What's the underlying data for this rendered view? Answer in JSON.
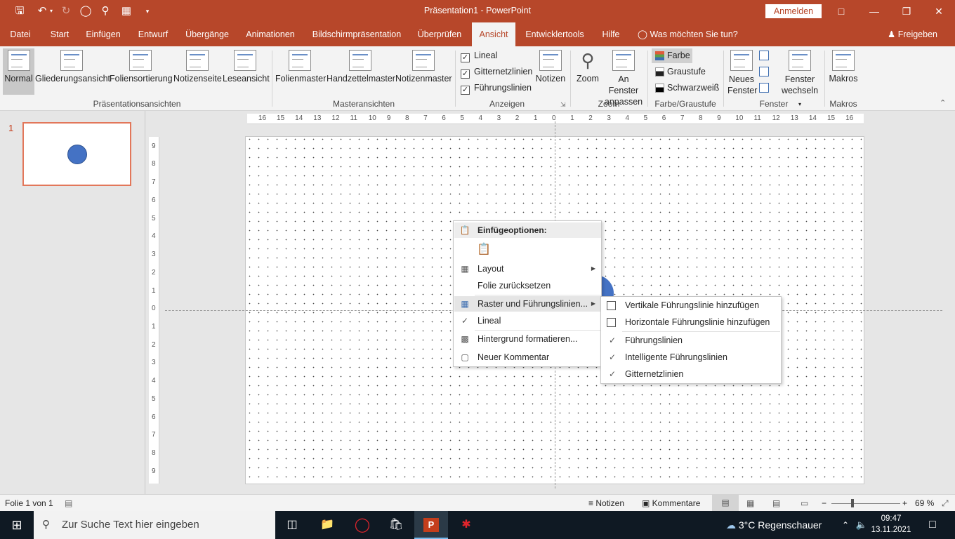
{
  "window": {
    "title": "Präsentation1  -  PowerPoint",
    "signin_label": "Anmelden",
    "minimize_icon": "minimize-icon",
    "restore_icon": "restore-icon",
    "close_icon": "close-icon"
  },
  "tabs": [
    {
      "label": "Datei"
    },
    {
      "label": "Start"
    },
    {
      "label": "Einfügen"
    },
    {
      "label": "Entwurf"
    },
    {
      "label": "Übergänge"
    },
    {
      "label": "Animationen"
    },
    {
      "label": "Bildschirmpräsentation"
    },
    {
      "label": "Überprüfen"
    },
    {
      "label": "Ansicht"
    },
    {
      "label": "Entwicklertools"
    },
    {
      "label": "Hilfe"
    }
  ],
  "active_tab": "Ansicht",
  "tellme": "Was möchten Sie tun?",
  "share": "Freigeben",
  "ribbon": {
    "praesentationsansichten": {
      "label": "Präsentationsansichten",
      "buttons": [
        "Normal",
        "Gliederungsansicht",
        "Foliensortierung",
        "Notizenseite",
        "Leseansicht"
      ]
    },
    "masteransichten": {
      "label": "Masteransichten",
      "buttons": [
        "Folienmaster",
        "Handzettelmaster",
        "Notizenmaster"
      ]
    },
    "anzeigen": {
      "label": "Anzeigen",
      "checkboxes": [
        {
          "label": "Lineal",
          "checked": true
        },
        {
          "label": "Gitternetzlinien",
          "checked": true
        },
        {
          "label": "Führungslinien",
          "checked": true
        }
      ],
      "notizen": "Notizen"
    },
    "zoom": {
      "label": "Zoom",
      "zoom_button": "Zoom",
      "fit_button_line1": "An Fenster",
      "fit_button_line2": "anpassen"
    },
    "farbe": {
      "label": "Farbe/Graustufe",
      "options": [
        {
          "label": "Farbe",
          "selected": true
        },
        {
          "label": "Graustufe",
          "selected": false
        },
        {
          "label": "Schwarzweiß",
          "selected": false
        }
      ]
    },
    "fenster": {
      "label": "Fenster",
      "new_window_line1": "Neues",
      "new_window_line2": "Fenster",
      "switch_line1": "Fenster",
      "switch_line2": "wechseln"
    },
    "makros": {
      "label": "Makros",
      "button": "Makros"
    }
  },
  "thumbnails": [
    {
      "number": "1"
    }
  ],
  "ruler": {
    "horizontal": [
      "16",
      "15",
      "14",
      "13",
      "12",
      "11",
      "10",
      "9",
      "8",
      "7",
      "6",
      "5",
      "4",
      "3",
      "2",
      "1",
      "0",
      "1",
      "2",
      "3",
      "4",
      "5",
      "6",
      "7",
      "8",
      "9",
      "10",
      "11",
      "12",
      "13",
      "14",
      "15",
      "16"
    ],
    "vertical": [
      "9",
      "8",
      "7",
      "6",
      "5",
      "4",
      "3",
      "2",
      "1",
      "0",
      "1",
      "2",
      "3",
      "4",
      "5",
      "6",
      "7",
      "8",
      "9"
    ]
  },
  "context_menu": {
    "header": "Einfügeoptionen:",
    "items": [
      {
        "label": "Layout",
        "has_submenu": true
      },
      {
        "label": "Folie zurücksetzen",
        "has_submenu": false
      },
      {
        "label": "Raster und Führungslinien...",
        "has_submenu": true
      },
      {
        "label": "Lineal",
        "checked": true
      },
      {
        "label": "Hintergrund formatieren...",
        "has_submenu": false
      },
      {
        "label": "Neuer Kommentar",
        "has_submenu": false
      }
    ]
  },
  "submenu": {
    "items": [
      {
        "label": "Vertikale Führungslinie hinzufügen",
        "checked": false
      },
      {
        "label": "Horizontale Führungslinie hinzufügen",
        "checked": false
      },
      {
        "label": "Führungslinien",
        "checked": true
      },
      {
        "label": "Intelligente Führungslinien",
        "checked": true
      },
      {
        "label": "Gitternetzlinien",
        "checked": true
      }
    ]
  },
  "statusbar": {
    "slide_info": "Folie 1 von 1",
    "notes": "Notizen",
    "comments": "Kommentare",
    "zoom_percent": "69 %",
    "zoom_minus": "−",
    "zoom_plus": "+"
  },
  "taskbar": {
    "search_placeholder": "Zur Suche Text hier eingeben",
    "weather": "3°C  Regenschauer",
    "time": "09:47",
    "date": "13.11.2021"
  },
  "colors": {
    "accent": "#b7472a",
    "shape_fill": "#4472c4"
  }
}
